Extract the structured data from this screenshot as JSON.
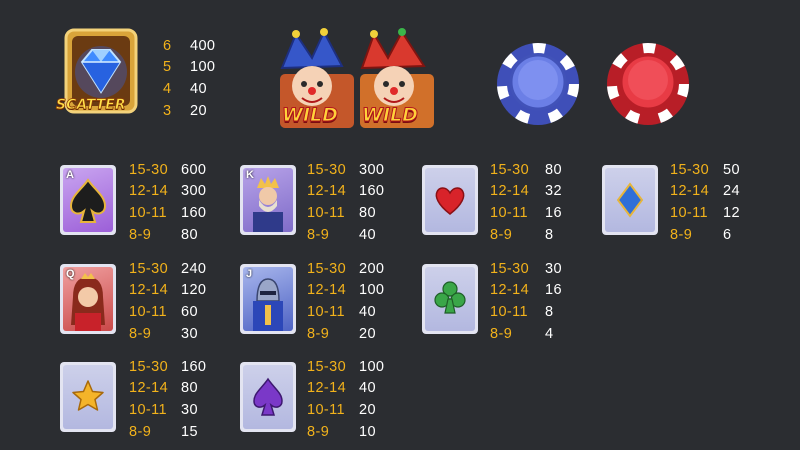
{
  "scatter": {
    "label": "SCATTER",
    "icon": "diamond-icon",
    "pays": [
      {
        "count": "6",
        "value": "400"
      },
      {
        "count": "5",
        "value": "100"
      },
      {
        "count": "4",
        "value": "40"
      },
      {
        "count": "3",
        "value": "20"
      }
    ]
  },
  "wild": {
    "label_1": "WILD",
    "label_2": "WILD",
    "icon": "jester-icon"
  },
  "chips": [
    {
      "name": "blue-chip-icon",
      "color": "#5b6fd6"
    },
    {
      "name": "red-chip-icon",
      "color": "#e03640"
    }
  ],
  "symbols": [
    {
      "id": "ace-spade",
      "letter": "A",
      "suit_color": "#1d1d1d",
      "pays": [
        {
          "count": "15-30",
          "value": "600"
        },
        {
          "count": "12-14",
          "value": "300"
        },
        {
          "count": "10-11",
          "value": "160"
        },
        {
          "count": "8-9",
          "value": "80"
        }
      ]
    },
    {
      "id": "king",
      "letter": "K",
      "suit_color": "#1d1d1d",
      "pays": [
        {
          "count": "15-30",
          "value": "300"
        },
        {
          "count": "12-14",
          "value": "160"
        },
        {
          "count": "10-11",
          "value": "80"
        },
        {
          "count": "8-9",
          "value": "40"
        }
      ]
    },
    {
      "id": "heart",
      "letter": "",
      "suit_color": "#d8232a",
      "pays": [
        {
          "count": "15-30",
          "value": "80"
        },
        {
          "count": "12-14",
          "value": "32"
        },
        {
          "count": "10-11",
          "value": "16"
        },
        {
          "count": "8-9",
          "value": "8"
        }
      ]
    },
    {
      "id": "diamond",
      "letter": "",
      "suit_color": "#2f6fd8",
      "pays": [
        {
          "count": "15-30",
          "value": "50"
        },
        {
          "count": "12-14",
          "value": "24"
        },
        {
          "count": "10-11",
          "value": "12"
        },
        {
          "count": "8-9",
          "value": "6"
        }
      ]
    },
    {
      "id": "queen",
      "letter": "Q",
      "suit_color": "#1d1d1d",
      "pays": [
        {
          "count": "15-30",
          "value": "240"
        },
        {
          "count": "12-14",
          "value": "120"
        },
        {
          "count": "10-11",
          "value": "60"
        },
        {
          "count": "8-9",
          "value": "30"
        }
      ]
    },
    {
      "id": "jack",
      "letter": "J",
      "suit_color": "#1d1d1d",
      "pays": [
        {
          "count": "15-30",
          "value": "200"
        },
        {
          "count": "12-14",
          "value": "100"
        },
        {
          "count": "10-11",
          "value": "40"
        },
        {
          "count": "8-9",
          "value": "20"
        }
      ]
    },
    {
      "id": "club",
      "letter": "",
      "suit_color": "#3aa648",
      "pays": [
        {
          "count": "15-30",
          "value": "30"
        },
        {
          "count": "12-14",
          "value": "16"
        },
        {
          "count": "10-11",
          "value": "8"
        },
        {
          "count": "8-9",
          "value": "4"
        }
      ]
    },
    {
      "id": "star",
      "letter": "",
      "suit_color": "#f4b42a",
      "pays": [
        {
          "count": "15-30",
          "value": "160"
        },
        {
          "count": "12-14",
          "value": "80"
        },
        {
          "count": "10-11",
          "value": "30"
        },
        {
          "count": "8-9",
          "value": "15"
        }
      ]
    },
    {
      "id": "spade",
      "letter": "",
      "suit_color": "#7a38c8",
      "pays": [
        {
          "count": "15-30",
          "value": "100"
        },
        {
          "count": "12-14",
          "value": "40"
        },
        {
          "count": "10-11",
          "value": "20"
        },
        {
          "count": "8-9",
          "value": "10"
        }
      ]
    }
  ]
}
